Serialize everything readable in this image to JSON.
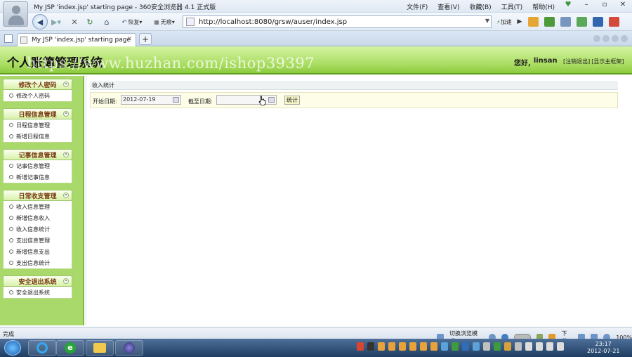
{
  "browser": {
    "window_title": "My JSP 'index.jsp' starting page - 360安全浏览器 4.1 正式版",
    "menu": [
      "文件(F)",
      "查看(V)",
      "收藏(B)",
      "工具(T)",
      "帮助(H)"
    ],
    "nav": {
      "recover_label": "恢复",
      "notrace_label": "无痕",
      "url": "http://localhost:8080/grsw/auser/index.jsp",
      "speed_label": "加速"
    },
    "tab": {
      "title": "My JSP 'index.jsp' starting page"
    }
  },
  "app": {
    "title": "个人账簿管理系统",
    "watermark": "https://www.huzhan.com/ishop39397",
    "greeting_label": "您好,",
    "username": "linsan",
    "logout_link": "[注销退出]",
    "home_link": "[显示主框架]",
    "menu": [
      {
        "title": "修改个人密码",
        "items": [
          "修改个人密码"
        ]
      },
      {
        "title": "日程信息管理",
        "items": [
          "日程信息管理",
          "新增日程信息"
        ]
      },
      {
        "title": "记事信息管理",
        "items": [
          "记事信息管理",
          "新增记事信息"
        ]
      },
      {
        "title": "日常收支管理",
        "items": [
          "收入信息管理",
          "新增信息收入",
          "收入信息统计",
          "支出信息管理",
          "新增信息支出",
          "支出信息统计"
        ]
      },
      {
        "title": "安全退出系统",
        "items": [
          "安全退出系统"
        ]
      }
    ],
    "breadcrumb": "收入统计",
    "form": {
      "start_label": "开始日期:",
      "start_value": "2012-07-19",
      "end_label": "截至日期:",
      "end_value": "",
      "submit_label": "统计"
    }
  },
  "statusbar": {
    "status": "完成",
    "mode_label": "切换浏览模式",
    "download_label": "下载",
    "zoom": "100%"
  },
  "taskbar": {
    "time": "23:17",
    "date": "2012-07-21"
  }
}
